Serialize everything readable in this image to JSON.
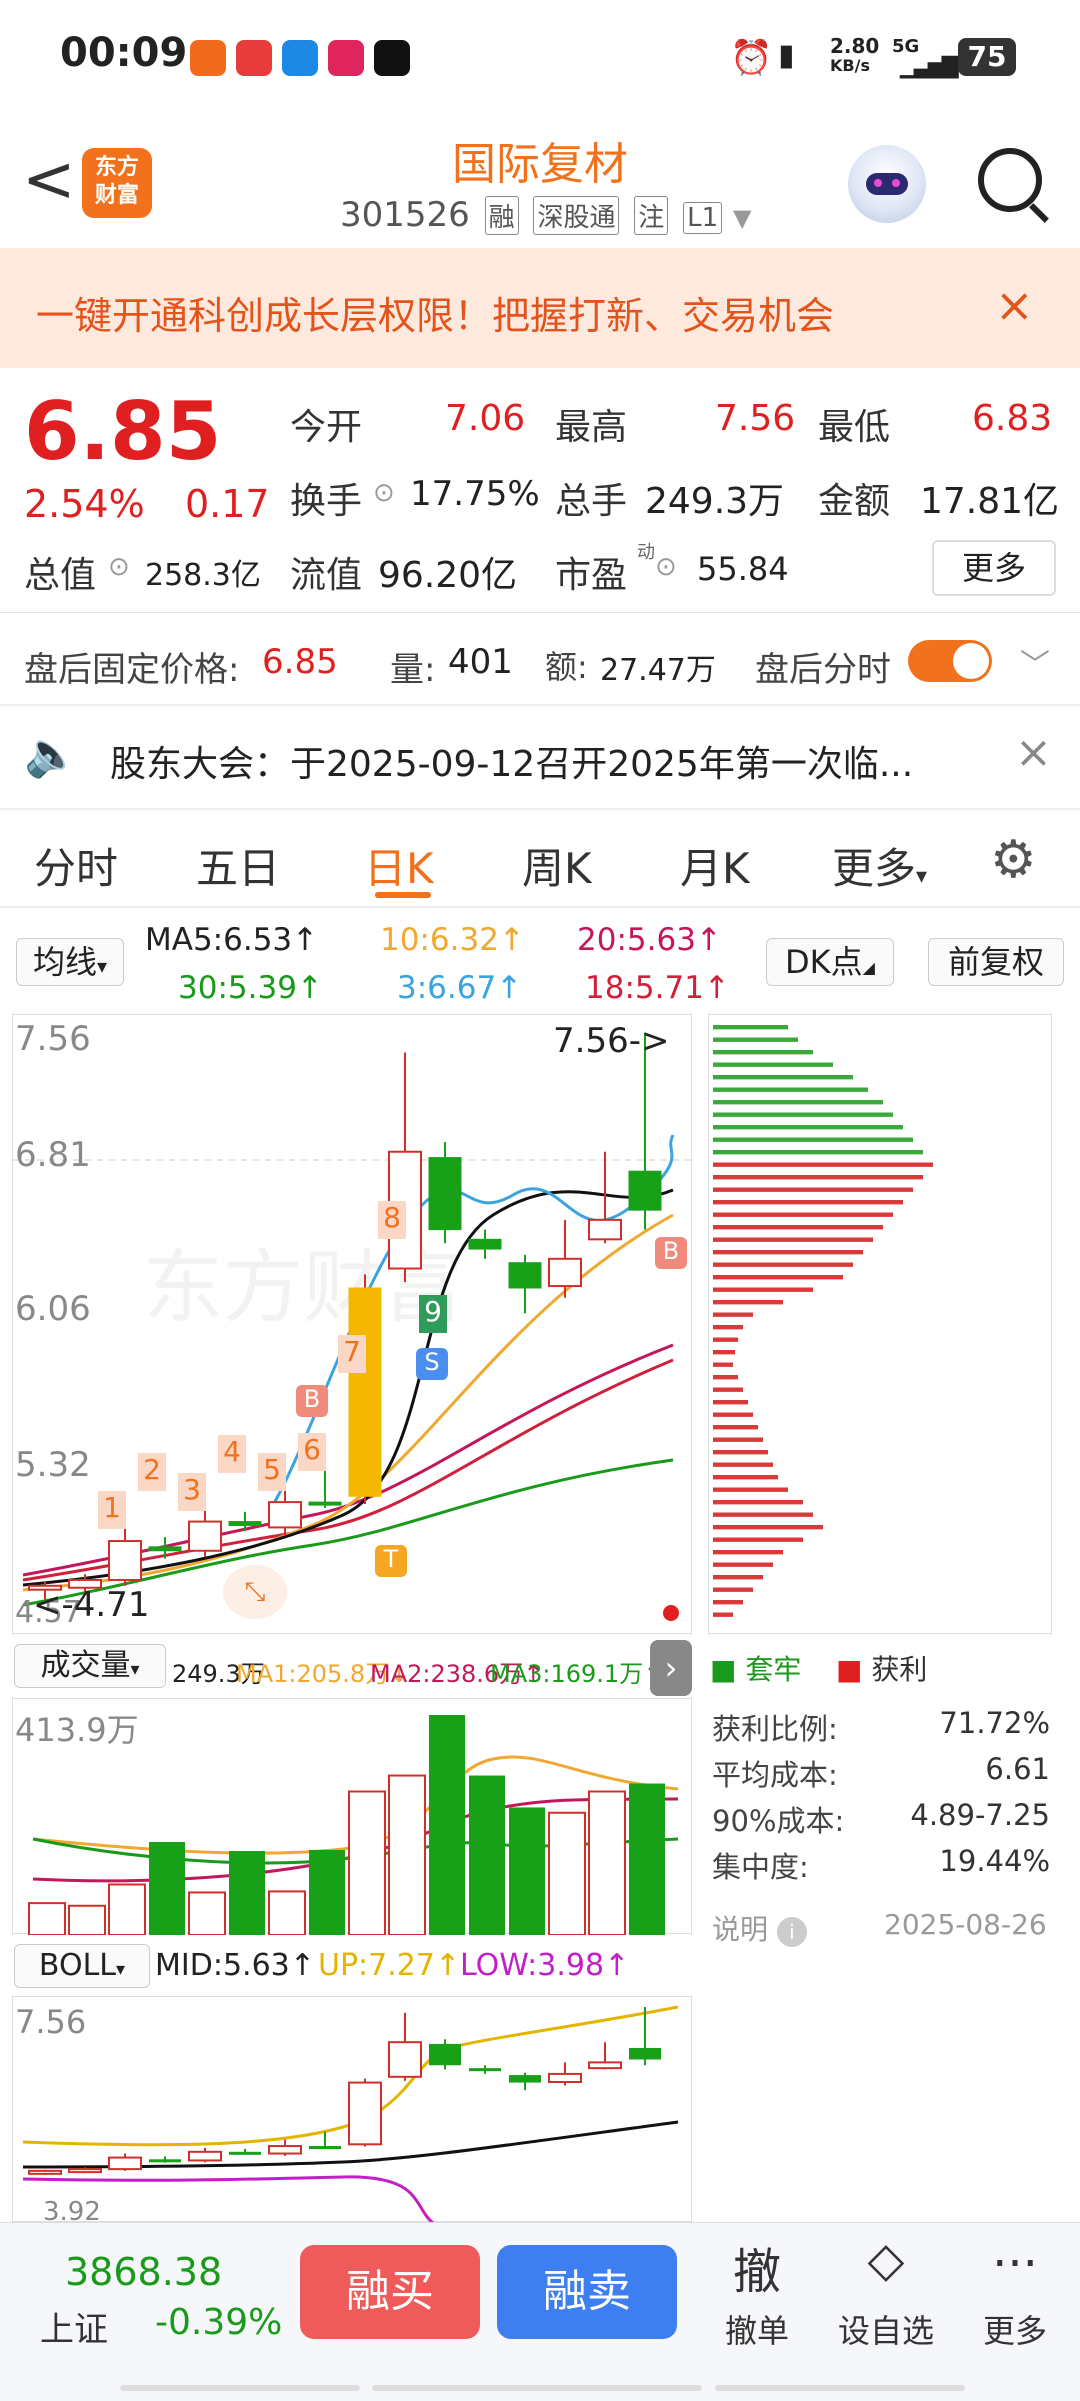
{
  "status_bar": {
    "time": "00:09",
    "net_speed": "2.80",
    "net_unit": "KB/s",
    "signal": "5G",
    "battery": "75"
  },
  "header": {
    "back": "<",
    "logo_line1": "东方",
    "logo_line2": "财富",
    "name": "国际复材",
    "code": "301526",
    "tags": [
      "融",
      "深股通",
      "注",
      "L1"
    ]
  },
  "banner": {
    "text": "一键开通科创成长层权限！把握打新、交易机会",
    "close": "×"
  },
  "quote": {
    "price": "6.85",
    "pct": "2.54%",
    "change": "0.17",
    "open_label": "今开",
    "open": "7.06",
    "high_label": "最高",
    "high": "7.56",
    "low_label": "最低",
    "low": "6.83",
    "turnover_label": "换手",
    "turnover": "17.75%",
    "vol_label": "总手",
    "vol": "249.3万",
    "amount_label": "金额",
    "amount": "17.81亿",
    "cap_label": "总值",
    "cap": "258.3亿",
    "float_label": "流值",
    "float": "96.20亿",
    "pe_label": "市盈",
    "pe_sup": "动",
    "pe": "55.84",
    "more": "更多"
  },
  "after_hours": {
    "label": "盘后固定价格:",
    "price": "6.85",
    "vol_label": "量:",
    "vol": "401",
    "amt_label": "额:",
    "amt": "27.47万",
    "toggle_label": "盘后分时"
  },
  "notice": {
    "text": "股东大会：于2025-09-12召开2025年第一次临..."
  },
  "tabs": [
    "分时",
    "五日",
    "日K",
    "周K",
    "月K",
    "更多"
  ],
  "ma_row": {
    "select": "均线",
    "ma5": "MA5:6.53",
    "ma10": "10:6.32",
    "ma20": "20:5.63",
    "ma30": "30:5.39",
    "ma3": "3:6.67",
    "ma18": "18:5.71",
    "dk": "DK点",
    "adjust": "前复权"
  },
  "kline": {
    "y_labels": [
      "7.56",
      "6.81",
      "6.06",
      "5.32",
      "4.57"
    ],
    "high_marker": "7.56->",
    "low_marker": "<-4.71",
    "nums": [
      "1",
      "2",
      "3",
      "4",
      "5",
      "6",
      "7",
      "8",
      "9"
    ],
    "signals": [
      "B",
      "B",
      "S",
      "T"
    ]
  },
  "chips": {
    "legend_trapped": "套牢",
    "legend_profit": "获利",
    "stats": [
      {
        "label": "获利比例:",
        "value": "71.72%"
      },
      {
        "label": "平均成本:",
        "value": "6.61"
      },
      {
        "label": "90%成本:",
        "value": "4.89-7.25"
      },
      {
        "label": "集中度:",
        "value": "19.44%"
      }
    ],
    "note": "说明",
    "date": "2025-08-26"
  },
  "volume": {
    "select": "成交量",
    "total": "249.3万",
    "ma1": "MA1:205.8万",
    "ma2": "MA2:238.6万",
    "ma3": "MA3:169.1万",
    "max_label": "413.9万"
  },
  "boll": {
    "select": "BOLL",
    "mid": "MID:5.63",
    "up": "UP:7.27",
    "low": "LOW:3.98",
    "top_label": "7.56",
    "bottom_label": "3.92"
  },
  "bottom": {
    "index_value": "3868.38",
    "index_name": "上证",
    "index_pct": "-0.39%",
    "buy": "融买",
    "sell": "融卖",
    "cancel_icon": "撤",
    "cancel": "撤单",
    "watch": "设自选",
    "more": "更多"
  },
  "colors": {
    "accent": "#f2711c",
    "up": "#e02020",
    "down": "#1a9a1a"
  },
  "chart_data": {
    "type": "candlestick",
    "ylim": [
      4.57,
      7.56
    ],
    "candles": [
      {
        "o": 4.7,
        "c": 4.72,
        "h": 4.74,
        "l": 4.65,
        "up": true
      },
      {
        "o": 4.71,
        "c": 4.75,
        "h": 4.78,
        "l": 4.68,
        "up": true
      },
      {
        "o": 4.75,
        "c": 4.95,
        "h": 5.02,
        "l": 4.72,
        "up": true
      },
      {
        "o": 4.92,
        "c": 4.9,
        "h": 4.97,
        "l": 4.86,
        "up": false
      },
      {
        "o": 4.9,
        "c": 5.05,
        "h": 5.12,
        "l": 4.87,
        "up": true
      },
      {
        "o": 5.05,
        "c": 5.03,
        "h": 5.1,
        "l": 5.0,
        "up": false
      },
      {
        "o": 5.02,
        "c": 5.15,
        "h": 5.26,
        "l": 4.98,
        "up": true
      },
      {
        "o": 5.15,
        "c": 5.15,
        "h": 5.4,
        "l": 5.12,
        "up": false
      },
      {
        "o": 5.18,
        "c": 6.25,
        "h": 6.32,
        "l": 5.14,
        "up": true
      },
      {
        "o": 6.35,
        "c": 6.95,
        "h": 7.46,
        "l": 6.28,
        "up": true
      },
      {
        "o": 6.92,
        "c": 6.55,
        "h": 7.0,
        "l": 6.48,
        "up": false
      },
      {
        "o": 6.5,
        "c": 6.45,
        "h": 6.55,
        "l": 6.4,
        "up": false
      },
      {
        "o": 6.38,
        "c": 6.25,
        "h": 6.42,
        "l": 6.12,
        "up": false
      },
      {
        "o": 6.26,
        "c": 6.4,
        "h": 6.6,
        "l": 6.2,
        "up": true
      },
      {
        "o": 6.5,
        "c": 6.6,
        "h": 6.95,
        "l": 6.48,
        "up": true
      },
      {
        "o": 6.85,
        "c": 6.65,
        "h": 7.56,
        "l": 6.55,
        "up": false
      }
    ],
    "volume": [
      60,
      55,
      95,
      175,
      80,
      158,
      82,
      160,
      270,
      300,
      413.9,
      300,
      240,
      230,
      270,
      285
    ],
    "chip_profile": {
      "trapped": [
        75,
        85,
        100,
        120,
        140,
        155,
        170,
        180,
        190,
        200,
        210
      ],
      "profit": [
        220,
        210,
        200,
        190,
        180,
        170,
        160,
        150,
        140,
        130,
        100,
        70,
        40,
        30,
        25,
        22,
        20,
        25,
        30,
        35,
        40,
        45,
        50,
        55,
        60,
        65,
        75,
        90,
        100,
        110,
        90,
        70,
        60,
        50,
        40,
        30,
        20
      ]
    }
  }
}
